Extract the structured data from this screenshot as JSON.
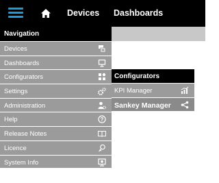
{
  "topbar": {
    "menu_icon": "hamburger-icon",
    "home_icon": "home-icon",
    "links": [
      "Devices",
      "Dashboards"
    ]
  },
  "navigation": {
    "title": "Navigation",
    "items": [
      {
        "label": "Devices",
        "icon": "devices-icon"
      },
      {
        "label": "Dashboards",
        "icon": "monitor-icon"
      },
      {
        "label": "Configurators",
        "icon": "configurators-icon"
      },
      {
        "label": "Settings",
        "icon": "gears-icon"
      },
      {
        "label": "Administration",
        "icon": "user-gear-icon"
      },
      {
        "label": "Help",
        "icon": "help-icon"
      },
      {
        "label": "Release Notes",
        "icon": "book-icon"
      },
      {
        "label": "Licence",
        "icon": "licence-icon"
      },
      {
        "label": "System Info",
        "icon": "system-info-icon"
      }
    ]
  },
  "submenu": {
    "title": "Configurators",
    "items": [
      {
        "label": "KPI Manager",
        "icon": "kpi-chart-icon",
        "active": false
      },
      {
        "label": "Sankey Manager",
        "icon": "share-icon",
        "active": true
      }
    ]
  },
  "colors": {
    "topbar": "#000000",
    "accent": "#1a9be0",
    "menu_item": "#9b9b9b",
    "menu_item_active": "#8a8a8a",
    "strip": "#c8c8c8"
  }
}
